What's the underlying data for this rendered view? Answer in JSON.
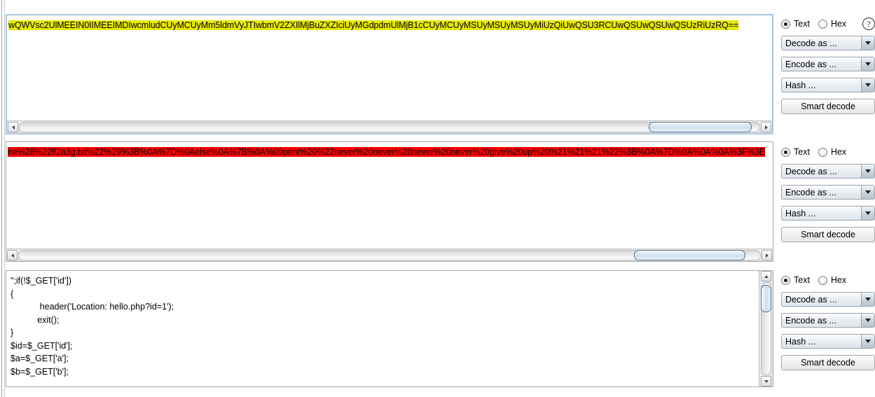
{
  "app": {
    "name": "Burp Suite Decoder"
  },
  "panels": [
    {
      "id": "panel-1",
      "focused": true,
      "highlight_color": "#e8e800",
      "text": "wQWVsc2UlMEEIN0IIMEEIMDIwcmludCUyMCUyMm5ldmVyJTIwbmV2ZXIlMjBuZXZIciUyMGdpdmUlMjB1cCUyMCUyMSUyMSUyMSUyMiUzQiUwQSU3RCUwQSUwQSUwQSUzRiUzRQ==",
      "radio_text_label": "Text",
      "radio_hex_label": "Hex",
      "radio_selected": "Text",
      "help_glyph": "?",
      "decode_label": "Decode as ...",
      "encode_label": "Encode as ...",
      "hash_label": "Hash ...",
      "smart_decode_label": "Smart decode",
      "hscroll": {
        "thumb_left_pct": 85,
        "thumb_width_pct": 14
      }
    },
    {
      "id": "panel-2",
      "focused": false,
      "highlight_color": "#ff0000",
      "text": "ire%28%22fl2a3g.txt%22%29%3B%0A%7D%0Aelse%0A%7B%0A%09print%20%22never%20never%20never%20never%20give%20up%20%21%21%21%22%3B%0A%7D%0A%0A%0A%3F%3E",
      "radio_text_label": "Text",
      "radio_hex_label": "Hex",
      "radio_selected": "Text",
      "decode_label": "Decode as ...",
      "encode_label": "Encode as ...",
      "hash_label": "Hash ...",
      "smart_decode_label": "Smart decode",
      "hscroll": {
        "thumb_left_pct": 83,
        "thumb_width_pct": 15
      }
    },
    {
      "id": "panel-3",
      "focused": false,
      "code_lines": [
        "\";if(!$_GET['id'])",
        "{",
        "            header('Location: hello.php?id=1');",
        "           exit();",
        "}",
        "$id=$_GET['id'];",
        "$a=$_GET['a'];",
        "$b=$_GET['b'];"
      ],
      "radio_text_label": "Text",
      "radio_hex_label": "Hex",
      "radio_selected": "Text",
      "decode_label": "Decode as ...",
      "encode_label": "Encode as ...",
      "hash_label": "Hash ...",
      "smart_decode_label": "Smart decode",
      "vscroll": {
        "thumb_top_pct": 2,
        "thumb_height_pct": 30
      }
    }
  ]
}
